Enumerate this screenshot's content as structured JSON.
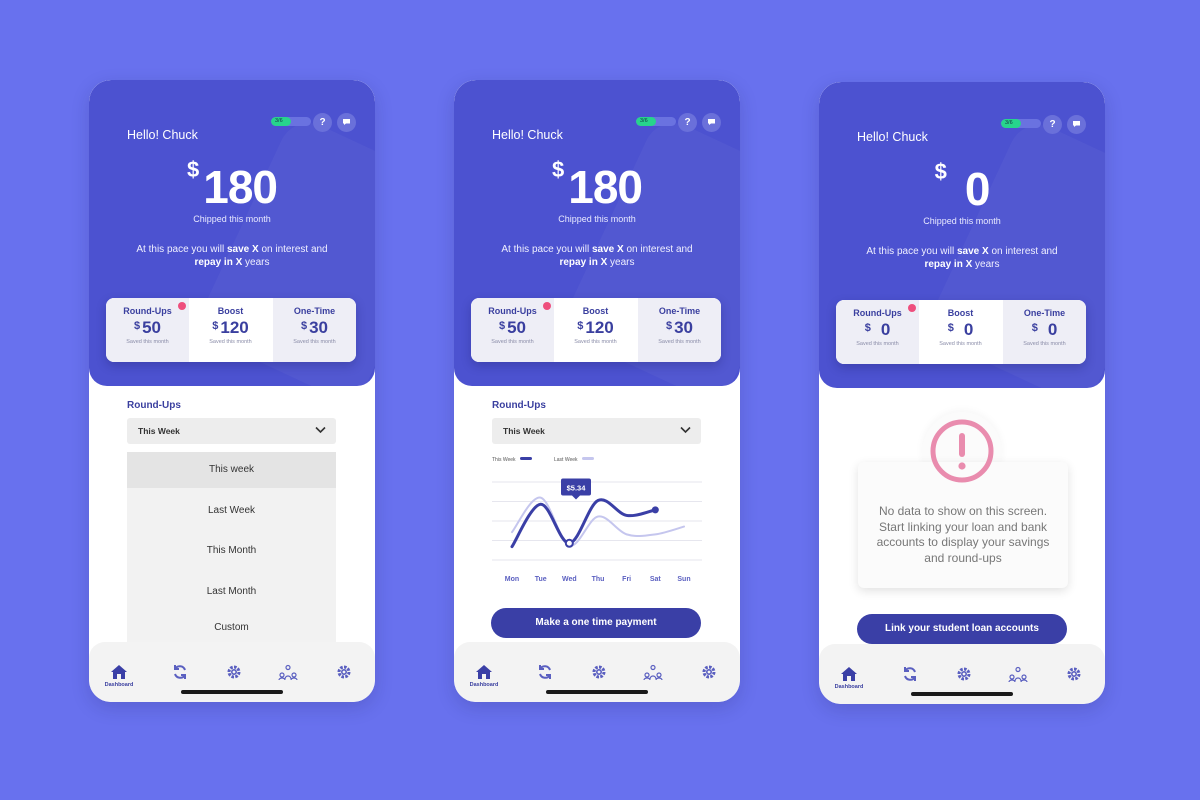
{
  "greeting": "Hello! Chuck",
  "currency": "$",
  "chipped_label": "Chipped this month",
  "pace": {
    "pre": "At this pace you will ",
    "b1": "save X",
    "mid1": " on interest and ",
    "b2": "repay in X",
    "post": " years"
  },
  "progress_label": "3/6",
  "progress_fraction": 0.5,
  "help_glyph": "?",
  "saved_label": "Saved this month",
  "card_titles": [
    "Round-Ups",
    "Boost",
    "One-Time"
  ],
  "screens": [
    {
      "amount": "180",
      "card_values": [
        "50",
        "120",
        "30"
      ]
    },
    {
      "amount": "180",
      "card_values": [
        "50",
        "120",
        "30"
      ]
    },
    {
      "amount": "0",
      "card_values": [
        "0",
        "0",
        "0"
      ]
    }
  ],
  "roundups_label": "Round-Ups",
  "select_value": "This Week",
  "dropdown_options": [
    "This week",
    "Last Week",
    "This Month",
    "Last Month",
    "Custom"
  ],
  "chart_data": {
    "type": "line",
    "categories": [
      "Mon",
      "Tue",
      "Wed",
      "Thu",
      "Fri",
      "Sat",
      "Sun"
    ],
    "legend": [
      "This Week",
      "Last Week"
    ],
    "series": [
      {
        "name": "This Week",
        "values": [
          1.2,
          5.0,
          1.5,
          5.34,
          4.0,
          4.5,
          null
        ],
        "color": "#3a3fa6"
      },
      {
        "name": "Last Week",
        "values": [
          2.5,
          5.6,
          1.3,
          3.9,
          2.3,
          2.3,
          3.0
        ],
        "color": "#c5c6ee"
      }
    ],
    "tooltip": "$5.34",
    "ylim": [
      0,
      7
    ]
  },
  "pay_button": "Make a one time payment",
  "empty_message": "No data to show on this screen. Start linking your loan and bank accounts to display your savings and round-ups",
  "link_button": "Link your student loan accounts",
  "tabbar": {
    "dashboard_label": "Dashboard"
  },
  "colors": {
    "background": "#6871ee",
    "hero": "#4c52d0",
    "accent": "#3a3fa6",
    "alert": "#ee4f7d",
    "progress": "#27d48c",
    "warning_pink": "#e98cae"
  }
}
